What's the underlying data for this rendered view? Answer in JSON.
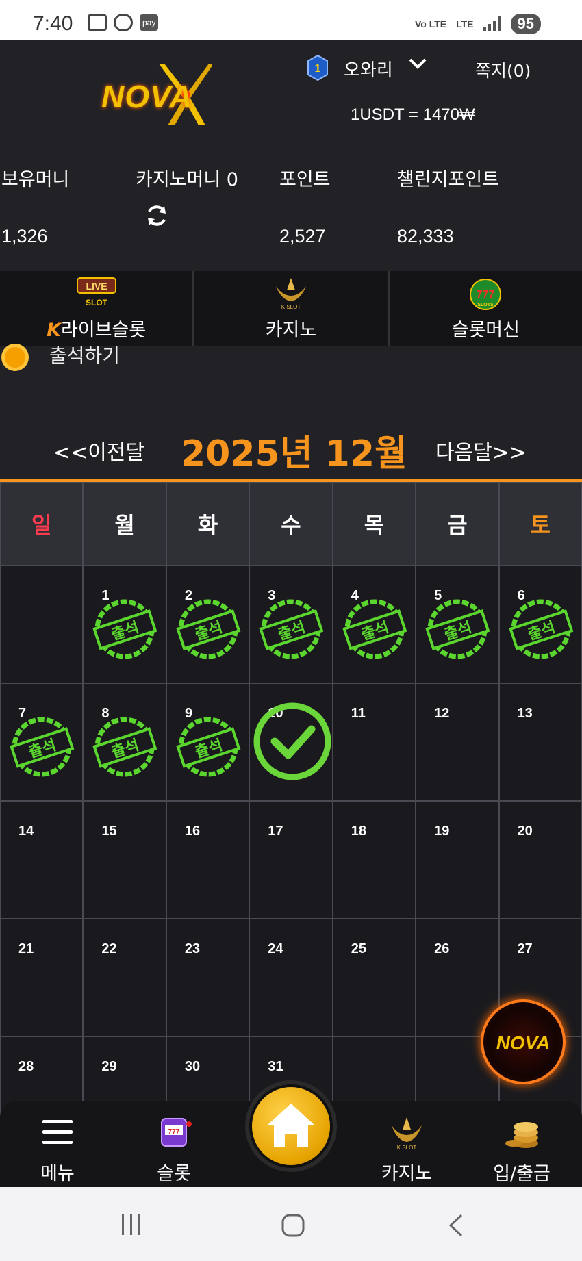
{
  "status_bar": {
    "time": "7:40",
    "pay_badge": "pay",
    "network": "Vo LTE",
    "network_type": "LTE",
    "battery": "95"
  },
  "header": {
    "logo_text": "NOVA",
    "rank_level": "1",
    "user_name": "오와리",
    "messages": "쪽지(0)",
    "exchange_rate": "1USDT = 1470₩"
  },
  "balances": [
    {
      "label": "보유머니",
      "value": "1,326"
    },
    {
      "label": "카지노머니 0",
      "value": ""
    },
    {
      "label": "포인트",
      "value": "2,527"
    },
    {
      "label": "챌린지포인트",
      "value": "82,333"
    }
  ],
  "categories": [
    {
      "label": "라이브슬롯",
      "icon": "live-slot-icon",
      "badge": "K"
    },
    {
      "label": "카지노",
      "icon": "k-slot-icon"
    },
    {
      "label": "슬롯머신",
      "icon": "777-slots-icon"
    }
  ],
  "attendance": {
    "label": "출석하기"
  },
  "month_nav": {
    "prev": "<<이전달",
    "current": "2025년 12월",
    "next": "다음달>>"
  },
  "weekdays": [
    "일",
    "월",
    "화",
    "수",
    "목",
    "금",
    "토"
  ],
  "stamp_text": "출석",
  "calendar": {
    "days": [
      "",
      "1",
      "2",
      "3",
      "4",
      "5",
      "6",
      "7",
      "8",
      "9",
      "10",
      "11",
      "12",
      "13",
      "14",
      "15",
      "16",
      "17",
      "18",
      "19",
      "20",
      "21",
      "22",
      "23",
      "24",
      "25",
      "26",
      "27",
      "28",
      "29",
      "30",
      "31",
      "",
      "",
      ""
    ],
    "stamped": [
      "1",
      "2",
      "3",
      "4",
      "5",
      "6",
      "7",
      "8",
      "9"
    ],
    "today_checked": "10"
  },
  "bottom_nav": [
    {
      "label": "메뉴",
      "icon": "hamburger-menu-icon"
    },
    {
      "label": "슬롯",
      "icon": "slot-machine-icon"
    },
    {
      "label": "",
      "icon": "home-icon"
    },
    {
      "label": "카지노",
      "icon": "k-slot-icon"
    },
    {
      "label": "입/출금",
      "icon": "coins-icon"
    }
  ],
  "colors": {
    "accent": "#f7941d",
    "sunday": "#ff3b50",
    "stamp_green": "#5ad62e",
    "background": "#222226"
  }
}
